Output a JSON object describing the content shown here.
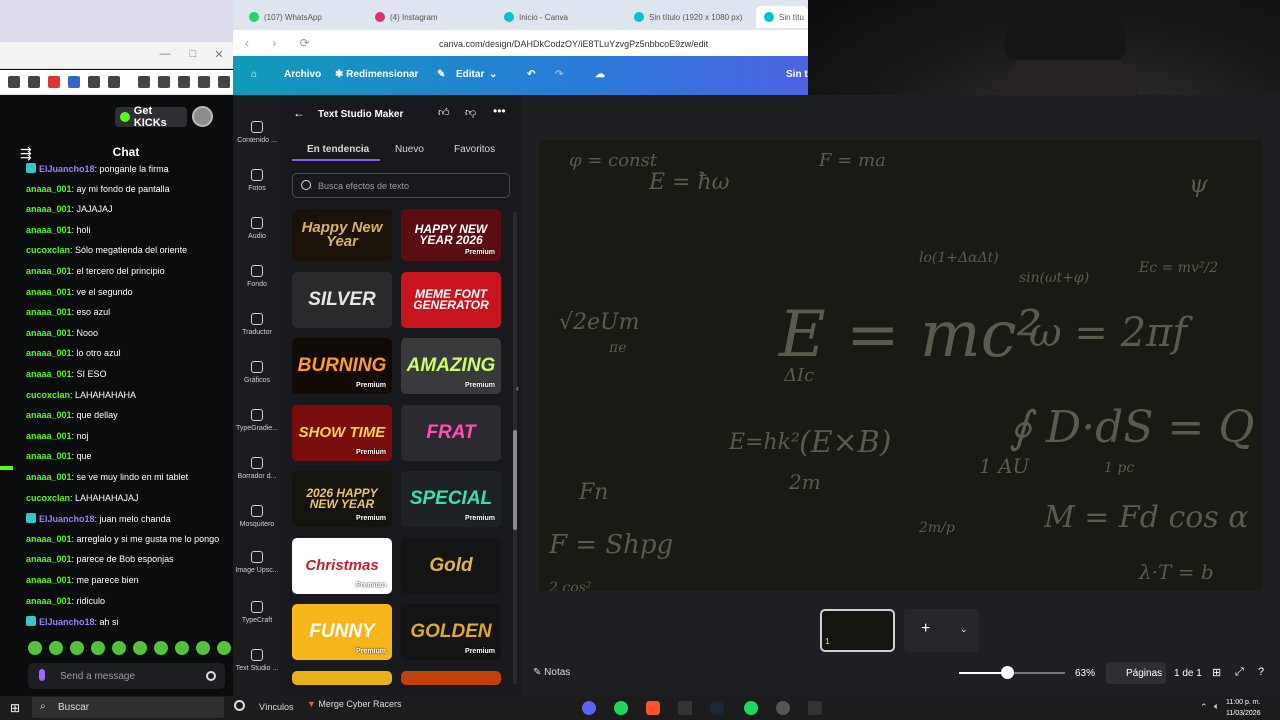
{
  "chat_window": {
    "get_kicks_label": "Get KICKs",
    "chat_title": "Chat",
    "messages": [
      {
        "user": "ElJuancho18",
        "text": ": ponganle la firma",
        "color": "purple"
      },
      {
        "user": "anaaa_001",
        "text": ": ay mi fondo de pantalla"
      },
      {
        "user": "anaaa_001",
        "text": ": JAJAJAJ"
      },
      {
        "user": "anaaa_001",
        "text": ": holi"
      },
      {
        "user": "cucoxclan",
        "text": ": Sólo megatienda del oriente"
      },
      {
        "user": "anaaa_001",
        "text": ": el tercero del principio"
      },
      {
        "user": "anaaa_001",
        "text": ": ve el segundo"
      },
      {
        "user": "anaaa_001",
        "text": ": eso azul"
      },
      {
        "user": "anaaa_001",
        "text": ": Nooo"
      },
      {
        "user": "anaaa_001",
        "text": ": lo otro azul"
      },
      {
        "user": "anaaa_001",
        "text": ": SI ESO"
      },
      {
        "user": "cucoxclan",
        "text": ": LAHAHAHAHA"
      },
      {
        "user": "anaaa_001",
        "text": ": que dellay"
      },
      {
        "user": "anaaa_001",
        "text": ": noj"
      },
      {
        "user": "anaaa_001",
        "text": ": que"
      },
      {
        "user": "anaaa_001",
        "text": ": se ve muy lindo en mi tablet"
      },
      {
        "user": "cucoxclan",
        "text": ": LAHAHAHAJAJ"
      },
      {
        "user": "ElJuancho18",
        "text": ": juan melo chanda",
        "color": "purple"
      },
      {
        "user": "anaaa_001",
        "text": ": arreglalo y si me gusta me lo pongo"
      },
      {
        "user": "anaaa_001",
        "text": ": parece de Bob esponjas"
      },
      {
        "user": "anaaa_001",
        "text": ": me parece bien"
      },
      {
        "user": "anaaa_001",
        "text": ": ridiculo"
      },
      {
        "user": "ElJuancho18",
        "text": ": ah si",
        "color": "purple"
      }
    ],
    "input_placeholder": "Send a message"
  },
  "browser": {
    "tabs": [
      {
        "label": "(107) WhatsApp",
        "color": "#25d366"
      },
      {
        "label": "(4) Instagram",
        "color": "#e1306c"
      },
      {
        "label": "Inicio - Canva",
        "color": "#00c4cc"
      },
      {
        "label": "Sin título (1920 x 1080 px)",
        "color": "#00c4cc"
      },
      {
        "label": "Sin títu",
        "color": "#00c4cc"
      }
    ],
    "url": "canva.com/design/DAHDkCodzOY/iE8TLuYzvgPz5nbbcoE9zw/edit"
  },
  "canva_toolbar": {
    "archivo": "Archivo",
    "redimensionar": "✱ Redimensionar",
    "editar": "Editar",
    "right_label": "Sin t"
  },
  "sidebar": [
    "Contenido ...",
    "Fotos",
    "Audio",
    "Fondo",
    "Traductor",
    "Gráficos",
    "TypeGradie...",
    "Borrador d...",
    "Mosquitero",
    "Image Upsc...",
    "TypeCraft",
    "Text Studio ..."
  ],
  "panel": {
    "title": "Text Studio Maker",
    "tabs": [
      "En tendencia",
      "Nuevo",
      "Favoritos"
    ],
    "search_placeholder": "Busca efectos de texto",
    "tiles": [
      {
        "text": "Happy New Year",
        "premium": false,
        "bg": "#1a1208",
        "fg": "#d6b25a"
      },
      {
        "text": "HAPPY NEW YEAR 2026",
        "premium": true,
        "bg": "#5a0d12",
        "fg": "#ffffff"
      },
      {
        "text": "SILVER",
        "premium": false,
        "bg": "#2a2a2c",
        "fg": "#e6e6e6"
      },
      {
        "text": "MEME FONT GENERATOR",
        "premium": false,
        "bg": "#c8141c",
        "fg": "#ffffff"
      },
      {
        "text": "BURNING",
        "premium": true,
        "bg": "#120a06",
        "fg": "#ff9a2a"
      },
      {
        "text": "AMAZING",
        "premium": true,
        "bg": "#3a3a3c",
        "fg": "#c8ff6a"
      },
      {
        "text": "SHOW TIME",
        "premium": true,
        "bg": "#7a0d0d",
        "fg": "#ffd44a"
      },
      {
        "text": "FRAT",
        "premium": false,
        "bg": "#2a2a30",
        "fg": "#ff4fb5"
      },
      {
        "text": "2026 HAPPY NEW YEAR",
        "premium": true,
        "bg": "#15130e",
        "fg": "#e8c46a"
      },
      {
        "text": "SPECIAL",
        "premium": true,
        "bg": "#1f2225",
        "fg": "#36e0b3"
      },
      {
        "text": "Christmas",
        "premium": true,
        "bg": "#ffffff",
        "fg": "#d01b2a"
      },
      {
        "text": "Gold",
        "premium": false,
        "bg": "#141414",
        "fg": "#e0b54a"
      },
      {
        "text": "FUNNY",
        "premium": true,
        "bg": "#f6b51b",
        "fg": "#ffffff"
      },
      {
        "text": "GOLDEN",
        "premium": true,
        "bg": "#141414",
        "fg": "#e0a82a"
      }
    ],
    "premium_label": "Premium"
  },
  "board": {
    "equations": [
      "E = mc²",
      "ω = 2πf",
      "∮ D·dS = Q",
      "F = ma",
      "1 AU",
      "1 pc",
      "M = Fd cos α",
      "E = ħω",
      "λ·T = b",
      "√2eUm",
      "ΔIc",
      "(E×B)",
      "F = Shpg",
      "2m",
      "ψ",
      "φ = const",
      "lo(1+ΔαΔt)",
      "E=hk²",
      "2 cos²",
      "sin(ωt+φ)",
      "πe",
      "2m/p",
      "Fn",
      "Ec = mv²/2"
    ]
  },
  "bottom": {
    "thumb_num": "1",
    "notes": "Notas",
    "zoom": "63%",
    "zoom_fraction": 0.45,
    "paginas": "Páginas",
    "page_count": "1 de 1"
  },
  "taskbar": {
    "search": "Buscar",
    "vinculos": "Vínculos",
    "app": "Merge Cyber Racers",
    "time": "11:00 p. m.",
    "date": "11/03/2026"
  }
}
